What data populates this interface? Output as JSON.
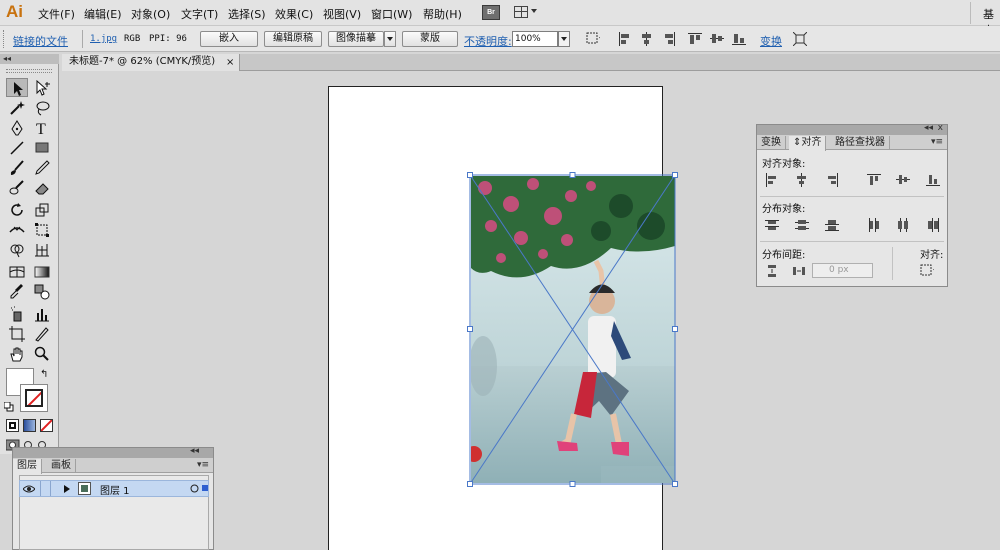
{
  "app": {
    "logo": "Ai"
  },
  "menu": {
    "items": [
      "文件(F)",
      "编辑(E)",
      "对象(O)",
      "文字(T)",
      "选择(S)",
      "效果(C)",
      "视图(V)",
      "窗口(W)",
      "帮助(H)"
    ],
    "bridge_label": "Br",
    "workspace_label": "基本"
  },
  "control_bar": {
    "linked_file_label": "链接的文件",
    "file_name": "1.jpg",
    "color_mode": "RGB",
    "ppi": "PPI: 96",
    "embed_label": "嵌入",
    "edit_original_label": "编辑原稿",
    "image_trace_label": "图像描摹",
    "mask_label": "蒙版",
    "opacity_label": "不透明度:",
    "opacity_value": "100%",
    "transform_label": "变换"
  },
  "document": {
    "tab_title": "未标题-7* @ 62% (CMYK/预览)",
    "close": "×"
  },
  "toolbox": {
    "collapse": "◂◂"
  },
  "align_panel": {
    "tabs": [
      "变换",
      "对齐",
      "路径查找器"
    ],
    "active_tab": "对齐",
    "align_objects_label": "对齐对象:",
    "distribute_objects_label": "分布对象:",
    "distribute_spacing_label": "分布间距:",
    "align_to_label": "对齐:",
    "spacing_value": "0 px",
    "collapse": "◂◂",
    "close": "x",
    "menu": "▾≡"
  },
  "layers_panel": {
    "tabs": [
      "图层",
      "画板"
    ],
    "layer_name": "图层 1",
    "collapse": "◂◂",
    "menu": "▾≡"
  },
  "colors": {
    "accent_link": "#1f5fb0",
    "selection": "#4a78c8",
    "layer_highlight": "#c4d8f2",
    "logo": "#c8720e"
  }
}
